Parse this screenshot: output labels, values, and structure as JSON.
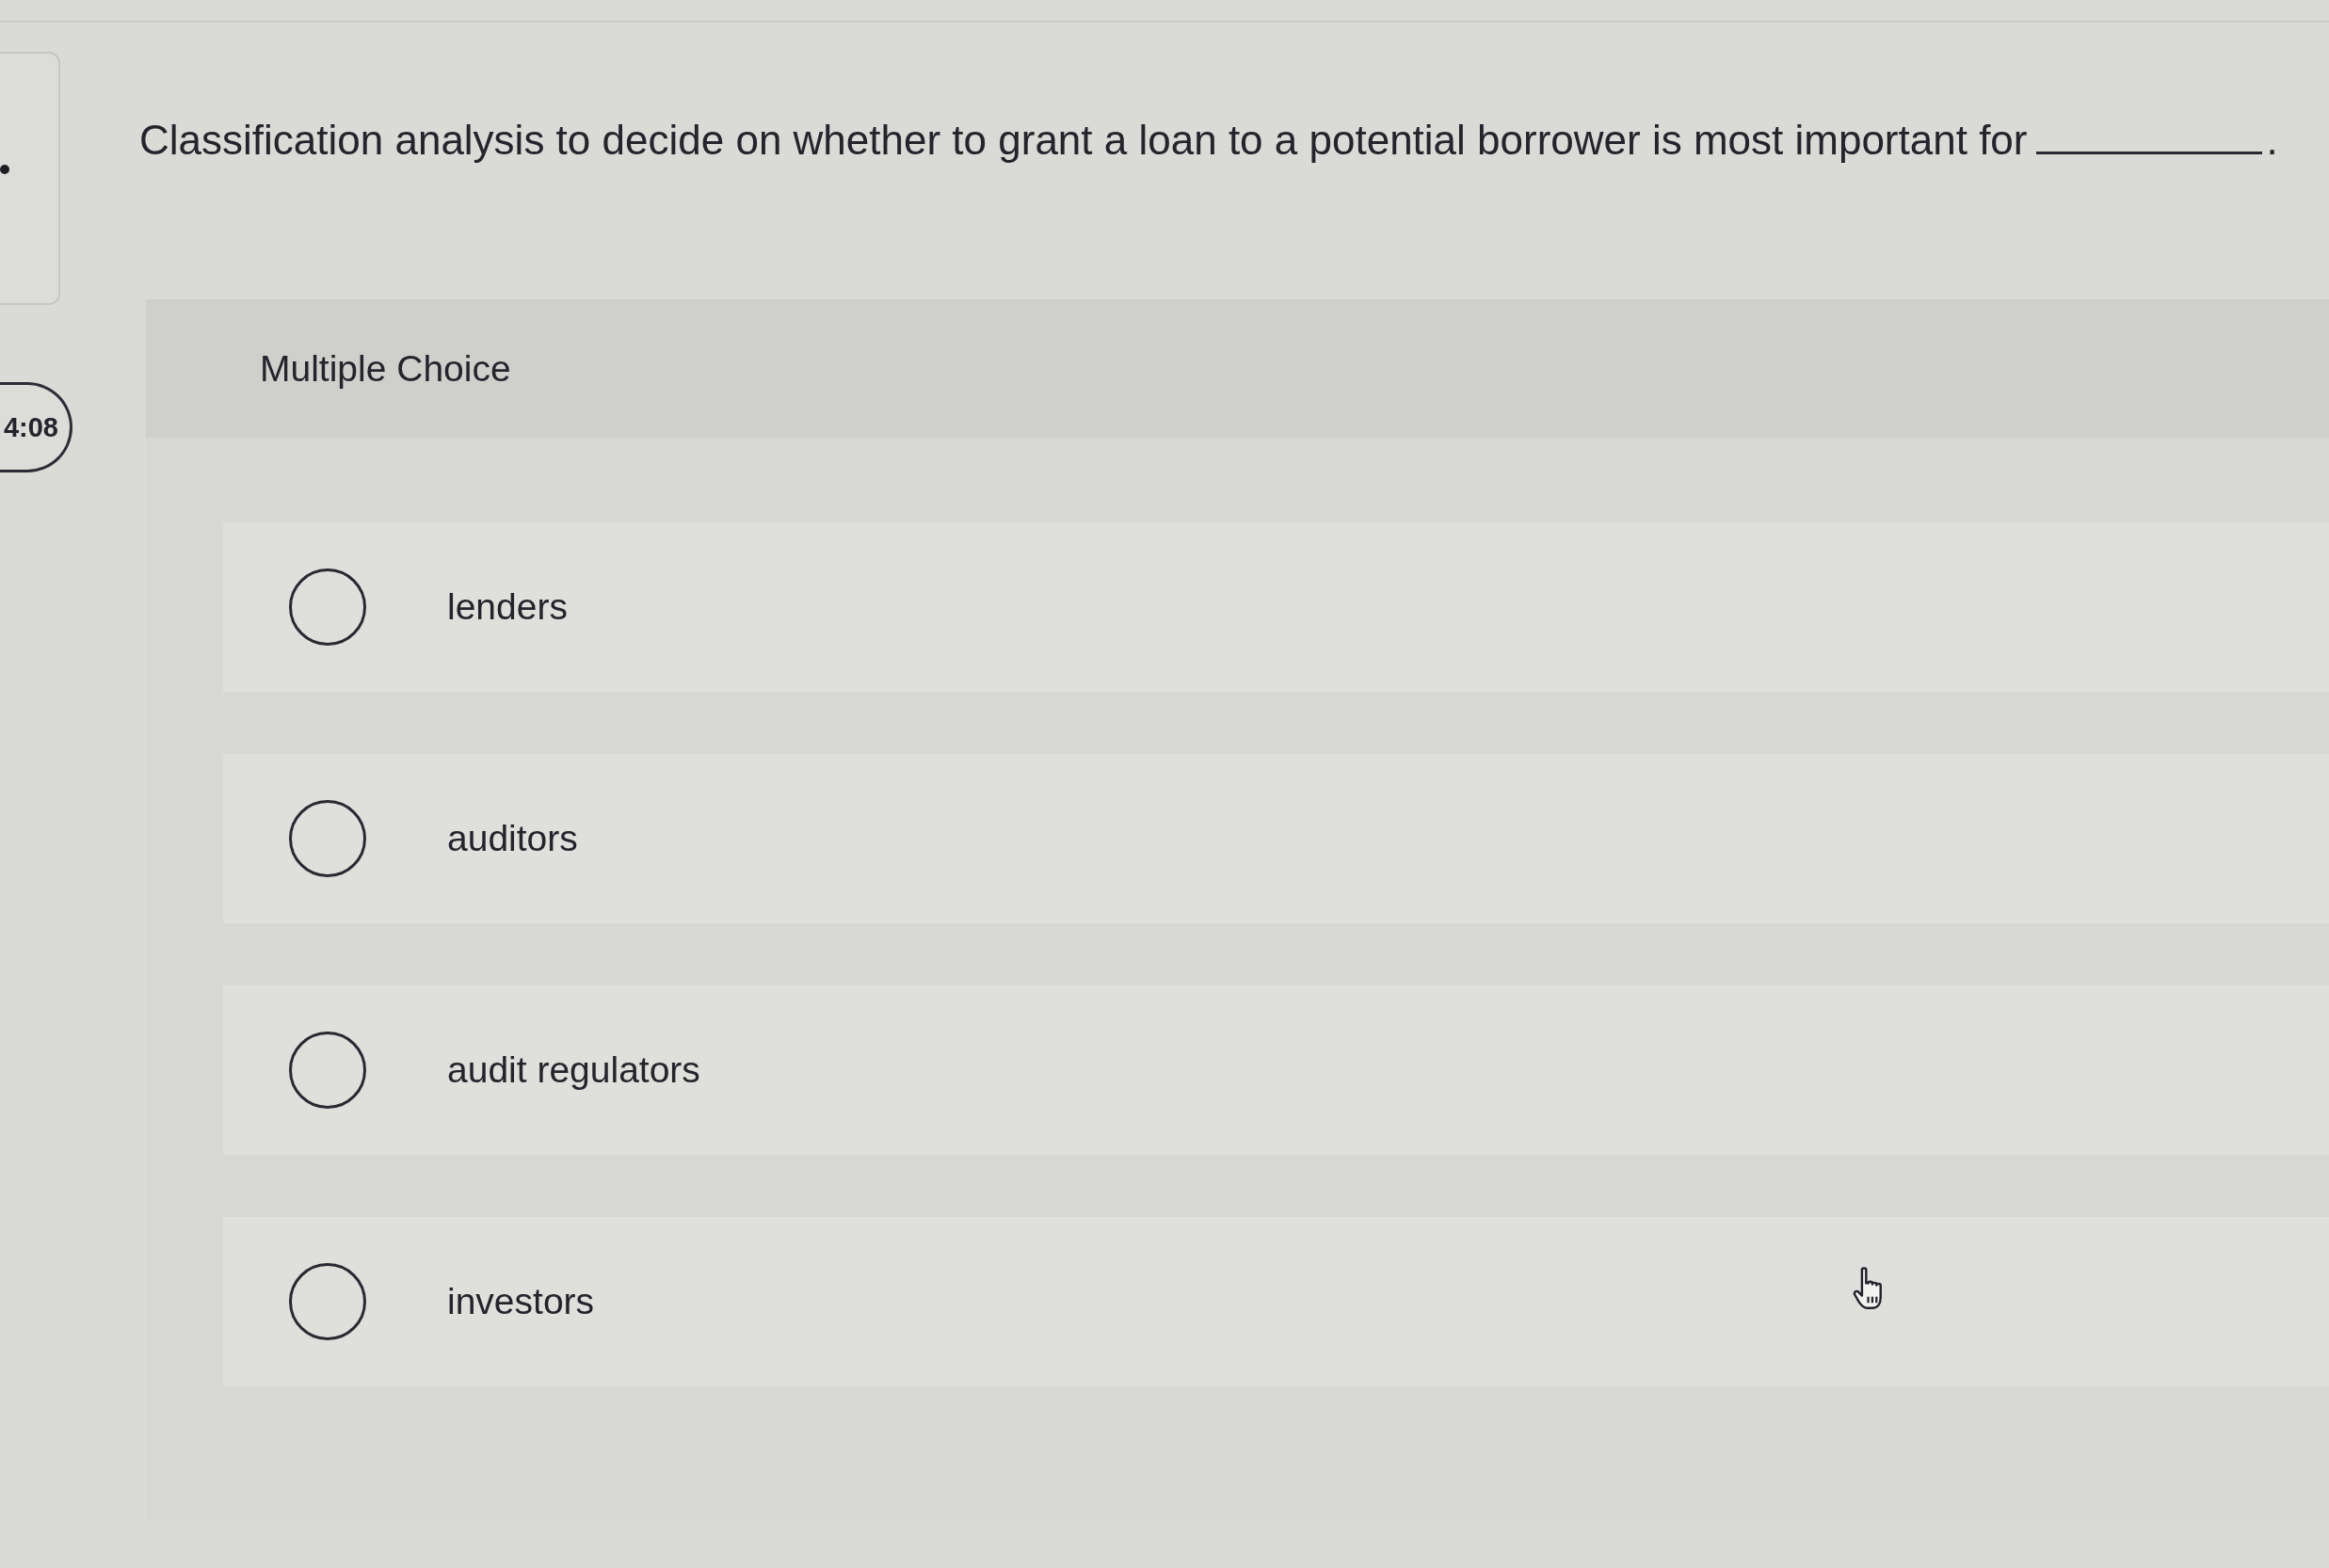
{
  "sidebar": {
    "timer": "4:08"
  },
  "question": {
    "text": "Classification analysis to decide on whether to grant a loan to a potential borrower is most important for",
    "end": "."
  },
  "quiz": {
    "heading": "Multiple Choice",
    "options": [
      {
        "label": "lenders",
        "selected": false
      },
      {
        "label": "auditors",
        "selected": false
      },
      {
        "label": "audit regulators",
        "selected": false
      },
      {
        "label": "investors",
        "selected": false
      }
    ]
  }
}
